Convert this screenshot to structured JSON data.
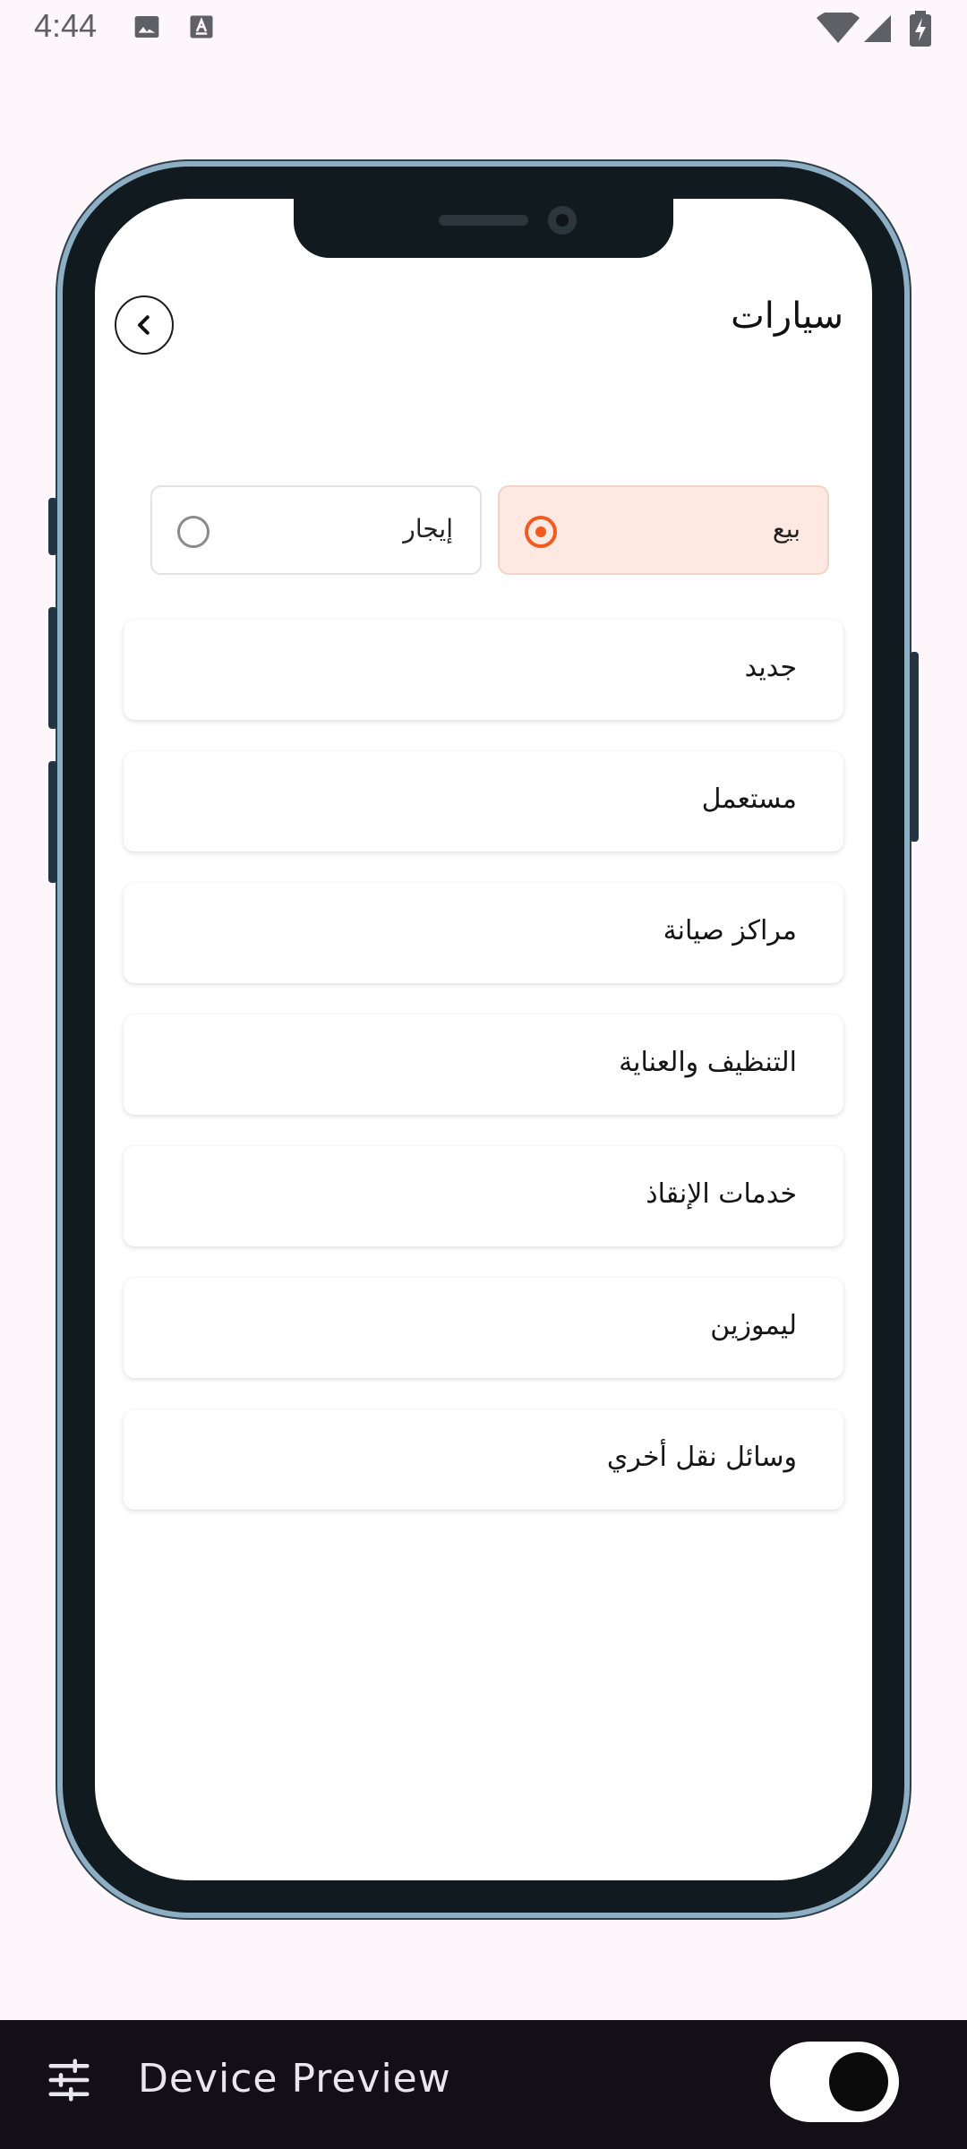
{
  "status_bar": {
    "time": "4:44",
    "icons": [
      "image-icon",
      "text-a-icon",
      "wifi-icon",
      "signal-icon",
      "battery-charging-icon"
    ]
  },
  "app": {
    "title": "سيارات",
    "back_icon": "chevron-left-icon",
    "accent_color": "#f25a1f",
    "transaction_type": {
      "options": [
        {
          "label": "بيع",
          "selected": true
        },
        {
          "label": "إيجار",
          "selected": false
        }
      ]
    },
    "categories": [
      {
        "label": "جديد"
      },
      {
        "label": "مستعمل"
      },
      {
        "label": "مراكز صيانة"
      },
      {
        "label": "التنظيف والعناية"
      },
      {
        "label": "خدمات الإنقاذ"
      },
      {
        "label": "ليموزين"
      },
      {
        "label": "وسائل نقل أخري"
      }
    ]
  },
  "device_preview": {
    "title": "Device Preview",
    "settings_icon": "sliders-icon",
    "toggle_on": true
  }
}
